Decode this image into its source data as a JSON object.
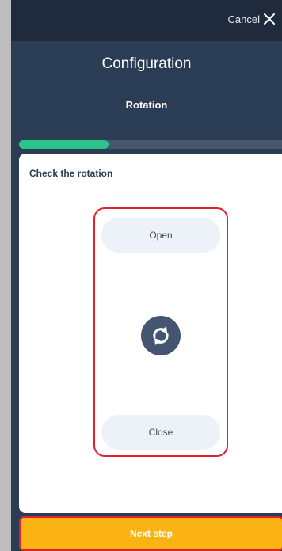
{
  "header": {
    "cancel_label": "Cancel",
    "close_icon": "close-icon"
  },
  "page": {
    "title": "Configuration",
    "subtitle": "Rotation"
  },
  "progress": {
    "fraction": 0.33,
    "fill_color": "#2bc48a",
    "track_color": "#46566c"
  },
  "card": {
    "heading": "Check the rotation",
    "open_label": "Open",
    "close_label": "Close",
    "rotate_icon": "rotate-icon"
  },
  "footer": {
    "next_label": "Next step",
    "button_color": "#fbb314"
  },
  "colors": {
    "background": "#2b3d55",
    "highlight": "#e0202c"
  }
}
